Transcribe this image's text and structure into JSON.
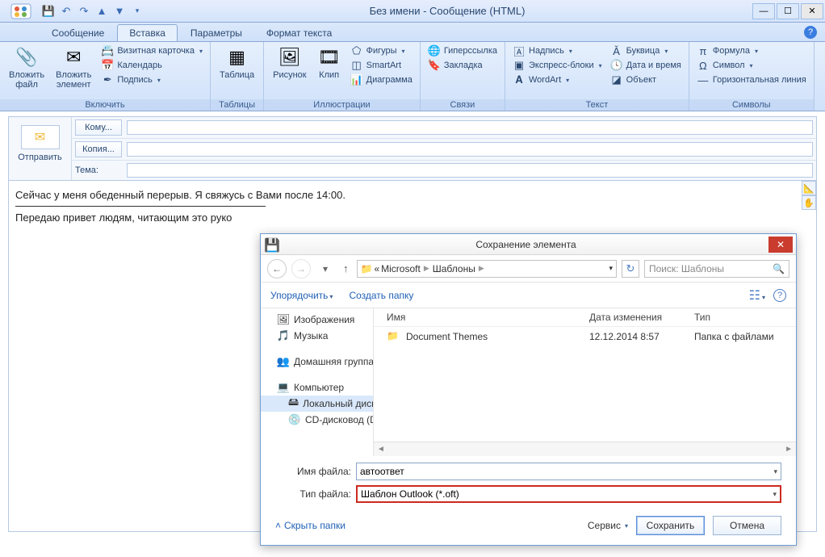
{
  "window": {
    "title": "Без имени - Сообщение (HTML)"
  },
  "tabs": {
    "t0": "Сообщение",
    "t1": "Вставка",
    "t2": "Параметры",
    "t3": "Формат текста"
  },
  "ribbon": {
    "g1": {
      "label": "Включить",
      "attach_file": "Вложить\nфайл",
      "attach_item": "Вложить\nэлемент",
      "bcard": "Визитная карточка",
      "cal": "Календарь",
      "sig": "Подпись"
    },
    "g2": {
      "label": "Таблицы",
      "table": "Таблица"
    },
    "g3": {
      "label": "Иллюстрации",
      "pic": "Рисунок",
      "clip": "Клип",
      "shapes": "Фигуры",
      "smartart": "SmartArt",
      "chart": "Диаграмма"
    },
    "g4": {
      "label": "Связи",
      "hyper": "Гиперссылка",
      "bookmark": "Закладка"
    },
    "g5": {
      "label": "Текст",
      "textbox": "Надпись",
      "quick": "Экспресс-блоки",
      "wordart": "WordArt",
      "dropcap": "Буквица",
      "datetime": "Дата и время",
      "object": "Объект"
    },
    "g6": {
      "label": "Символы",
      "eq": "Формула",
      "sym": "Символ",
      "hr": "Горизонтальная линия"
    }
  },
  "compose": {
    "send": "Отправить",
    "to": "Кому...",
    "cc": "Копия...",
    "subject": "Тема:"
  },
  "body": {
    "line1": "Сейчас у меня обеденный перерыв. Я свяжусь с Вами после 14:00.",
    "line2": "Передаю привет людям, читающим это руко"
  },
  "dialog": {
    "title": "Сохранение элемента",
    "crumb": {
      "p0": "«",
      "p1": "Microsoft",
      "p2": "Шаблоны"
    },
    "search_ph": "Поиск: Шаблоны",
    "organize": "Упорядочить",
    "newfolder": "Создать папку",
    "nav": {
      "pics": "Изображения",
      "music": "Музыка",
      "homegroup": "Домашняя группа",
      "computer": "Компьютер",
      "localdisk": "Локальный диск",
      "cddrive": "CD-дисковод (D:"
    },
    "cols": {
      "name": "Имя",
      "date": "Дата изменения",
      "type": "Тип"
    },
    "row": {
      "name": "Document Themes",
      "date": "12.12.2014 8:57",
      "type": "Папка с файлами"
    },
    "fname_l": "Имя файла:",
    "fname_v": "автоответ",
    "ftype_l": "Тип файла:",
    "ftype_v": "Шаблон Outlook (*.oft)",
    "hide": "Скрыть папки",
    "service": "Сервис",
    "save": "Сохранить",
    "cancel": "Отмена"
  }
}
